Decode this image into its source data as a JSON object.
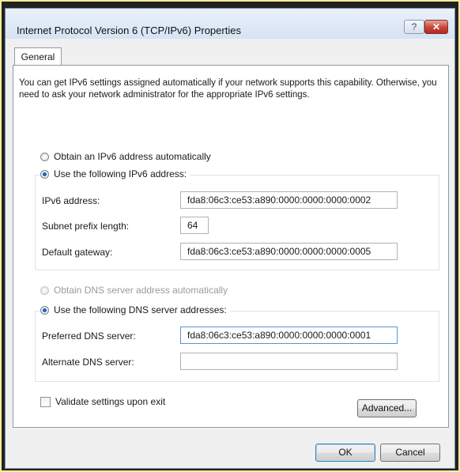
{
  "window": {
    "title": "Internet Protocol Version 6 (TCP/IPv6) Properties",
    "help_label": "?",
    "close_label": "✕"
  },
  "tabs": [
    {
      "label": "General"
    }
  ],
  "intro": "You can get IPv6 settings assigned automatically if your network supports this capability. Otherwise, you need to ask your network administrator for the appropriate IPv6 settings.",
  "ip_section": {
    "auto_label": "Obtain an IPv6 address automatically",
    "manual_label": "Use the following IPv6 address:",
    "selected": "manual",
    "fields": [
      {
        "label": "IPv6 address:",
        "value": "fda8:06c3:ce53:a890:0000:0000:0000:0002"
      },
      {
        "label": "Subnet prefix length:",
        "value": "64"
      },
      {
        "label": "Default gateway:",
        "value": "fda8:06c3:ce53:a890:0000:0000:0000:0005"
      }
    ]
  },
  "dns_section": {
    "auto_label": "Obtain DNS server address automatically",
    "manual_label": "Use the following DNS server addresses:",
    "selected": "manual",
    "fields": [
      {
        "label": "Preferred DNS server:",
        "value": "fda8:06c3:ce53:a890:0000:0000:0000:0001"
      },
      {
        "label": "Alternate DNS server:",
        "value": ""
      }
    ]
  },
  "validate_label": "Validate settings upon exit",
  "validate_checked": false,
  "buttons": {
    "advanced": "Advanced...",
    "ok": "OK",
    "cancel": "Cancel"
  }
}
